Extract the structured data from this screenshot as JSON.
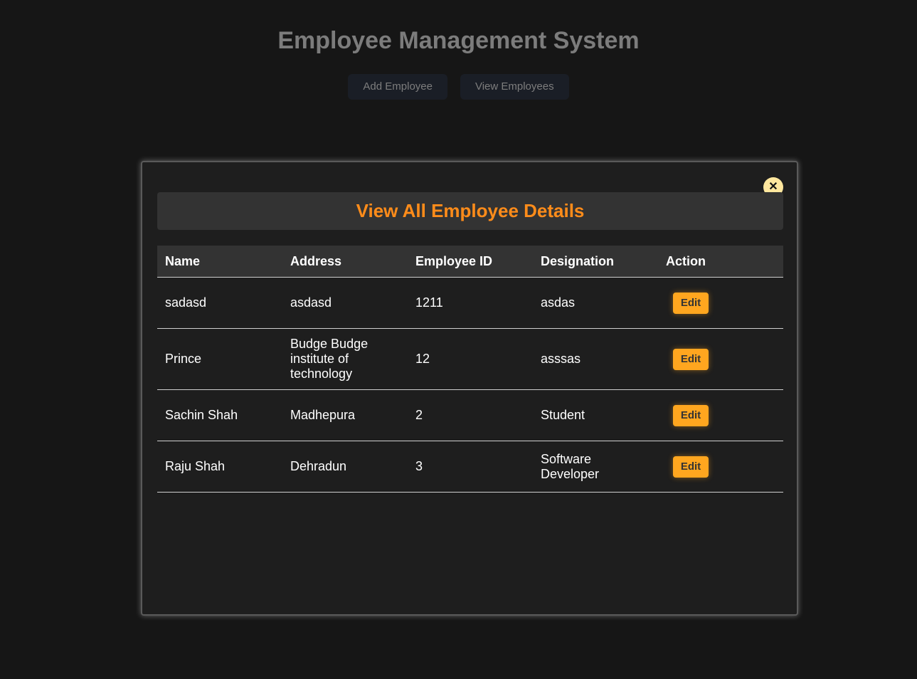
{
  "page": {
    "title": "Employee Management System"
  },
  "nav": {
    "add_label": "Add Employee",
    "view_label": "View Employees"
  },
  "modal": {
    "close_symbol": "✕",
    "title": "View All Employee Details"
  },
  "table": {
    "headers": [
      "Name",
      "Address",
      "Employee ID",
      "Designation",
      "Action"
    ],
    "rows": [
      {
        "name": "sadasd",
        "address": "asdasd",
        "employee_id": "1211",
        "designation": "asdas",
        "action": "Edit"
      },
      {
        "name": "Prince",
        "address": "Budge Budge institute of technology",
        "employee_id": "12",
        "designation": "asssas",
        "action": "Edit"
      },
      {
        "name": "Sachin Shah",
        "address": "Madhepura",
        "employee_id": "2",
        "designation": "Student",
        "action": "Edit"
      },
      {
        "name": "Raju Shah",
        "address": "Dehradun",
        "employee_id": "3",
        "designation": "Software Developer",
        "action": "Edit"
      }
    ]
  },
  "colors": {
    "accent": "#ff8c1a",
    "edit_button": "#ffa61f",
    "close_button": "#ffe79e",
    "background": "#161616"
  }
}
